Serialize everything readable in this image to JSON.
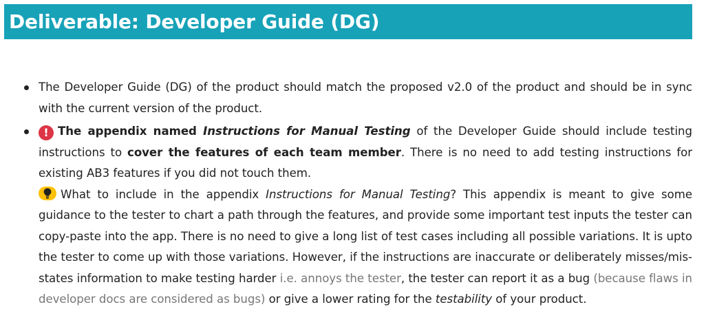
{
  "heading": "Deliverable: Developer Guide (DG)",
  "icons": {
    "alert": "exclamation-circle-icon",
    "tip": "lightbulb-icon",
    "alert_color": "#dc3545",
    "tip_color": "#ffc107",
    "banner_color": "#17a2b8"
  },
  "items": [
    {
      "text": "The Developer Guide (DG) of the product should match the proposed v2.0 of the product and should be in sync with the current version of the product."
    },
    {
      "alert_glyph": "!",
      "bold_1": "The appendix named ",
      "bold_italic": "Instructions for Manual Testing",
      "text_1": " of the Developer Guide should include testing instructions to ",
      "bold_2": "cover the features of each team member",
      "text_2": ". There is no need to add testing instructions for existing AB3 features if you did not touch them.",
      "tip": {
        "text_1": "What to include in the appendix ",
        "italic_1": "Instructions for Manual Testing",
        "text_2": "? This appendix is meant to give some guidance to the tester to chart a path through the features, and provide some important test inputs the tester can copy-paste into the app. There is no need to give a long list of test cases including all possible variations. It is upto the tester to come up with those variations. However, if the instructions are inaccurate or deliberately misses/mis-states information to make testing harder ",
        "muted_1": "i.e. annoys the tester",
        "text_3": ", the tester can report it as a bug ",
        "muted_2": "(because flaws in developer docs are considered as bugs)",
        "text_4": " or give a lower rating for the ",
        "italic_2": "testability",
        "text_5": " of your product."
      }
    }
  ]
}
